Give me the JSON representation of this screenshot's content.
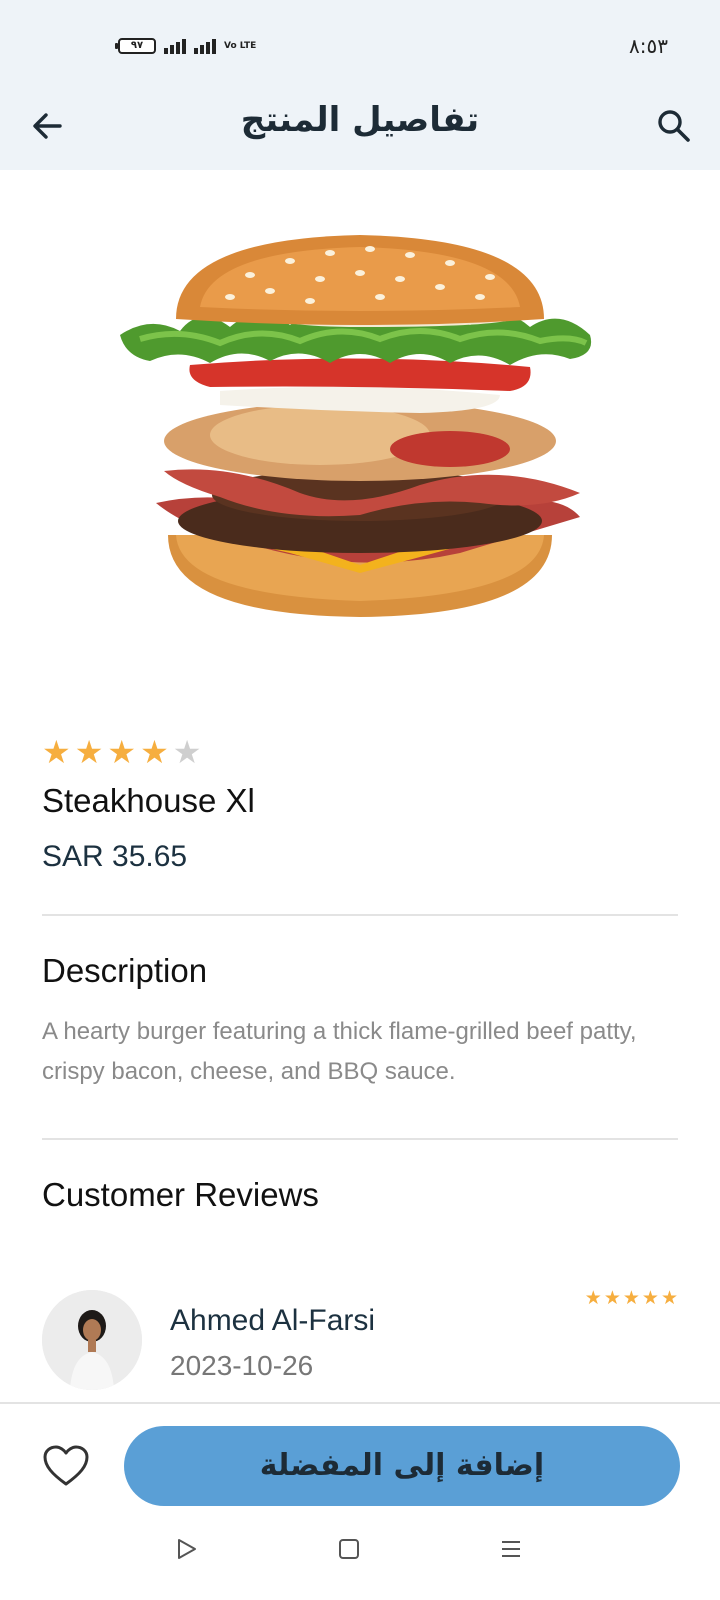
{
  "status_bar": {
    "time": "٨:٥٣",
    "battery": "٩٧",
    "network": "Vo LTE"
  },
  "header": {
    "title": "تفاصيل المنتج",
    "back_icon": "arrow-left-icon",
    "search_icon": "search-icon"
  },
  "product": {
    "image": "burger-image",
    "rating": 4,
    "rating_max": 5,
    "name": "Steakhouse Xl",
    "price": "SAR 35.65"
  },
  "description": {
    "title": "Description",
    "text": "A hearty burger featuring a thick flame-grilled beef patty, crispy bacon, cheese, and BBQ sauce."
  },
  "reviews": {
    "title": "Customer Reviews",
    "items": [
      {
        "name": "Ahmed Al-Farsi",
        "date": "2023-10-26",
        "rating": 5
      }
    ]
  },
  "actions": {
    "favorite_icon": "heart-outline-icon",
    "add_to_favorites": "إضافة إلى المفضلة"
  },
  "navbar": {
    "icons": [
      "back-triangle-icon",
      "home-square-icon",
      "menu-lines-icon"
    ]
  },
  "colors": {
    "accent": "#5a9fd6",
    "star": "#f6ae3f",
    "header_bg": "#eef3f8"
  }
}
